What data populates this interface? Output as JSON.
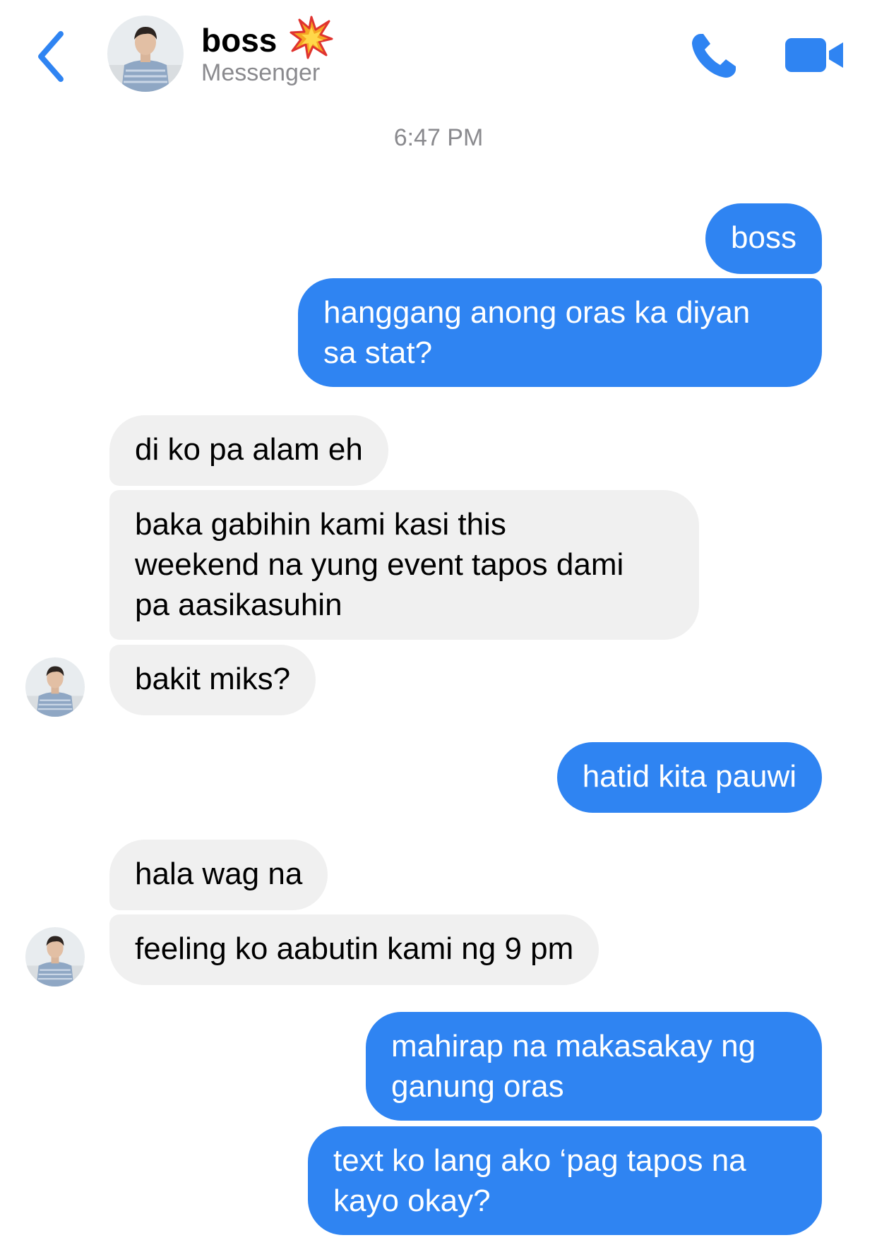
{
  "header": {
    "back_icon": "chevron-left-icon",
    "contact_name": "boss",
    "name_emoji": "collision-emoji",
    "subtitle": "Messenger",
    "call_icon": "phone-icon",
    "video_icon": "video-camera-icon"
  },
  "timestamp": "6:47 PM",
  "colors": {
    "accent": "#2f84f2",
    "incoming_bubble": "#f0f0f0",
    "muted_text": "#8a8a8e"
  },
  "messages": [
    {
      "sender": "me",
      "text": "boss"
    },
    {
      "sender": "me",
      "text": "hanggang anong oras ka diyan\nsa stat?"
    },
    {
      "sender": "boss",
      "text": "di ko pa alam eh"
    },
    {
      "sender": "boss",
      "text": "baka gabihin kami kasi this\nweekend na yung event tapos dami\npa aasikasuhin"
    },
    {
      "sender": "boss",
      "text": "bakit miks?"
    },
    {
      "sender": "me",
      "text": "hatid kita pauwi"
    },
    {
      "sender": "boss",
      "text": "hala wag na"
    },
    {
      "sender": "boss",
      "text": "feeling ko aabutin kami ng 9 pm"
    },
    {
      "sender": "me",
      "text": "mahirap na makasakay ng\nganung oras"
    },
    {
      "sender": "me",
      "text": "text ko lang ako ‘pag tapos na\nkayo okay?"
    }
  ]
}
